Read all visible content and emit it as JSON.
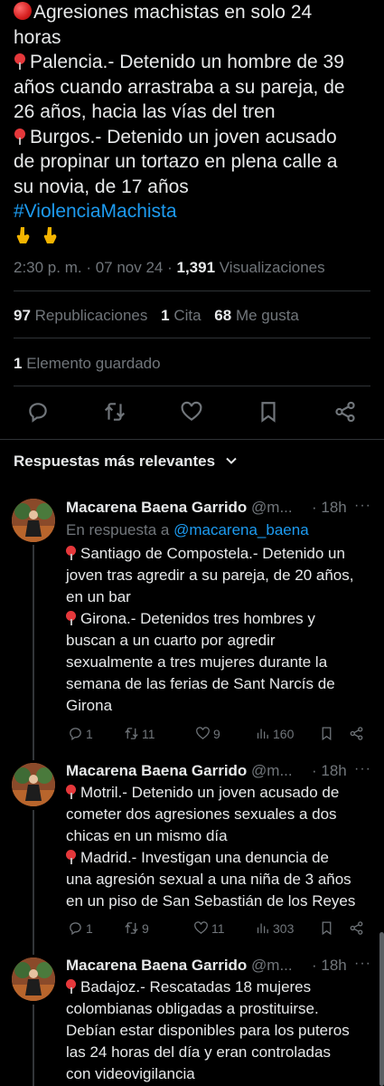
{
  "tweet": {
    "lines": [
      "Agresiones machistas en solo 24",
      "horas",
      "Palencia.- Detenido un hombre de 39",
      "años cuando arrastraba a su pareja, de",
      "26 años, hacia las vías del tren",
      "Burgos.- Detenido un joven acusado",
      "de propinar un tortazo en plena calle a",
      "su novia, de 17 años"
    ],
    "hashtag": "#ViolenciaMachista",
    "time": "2:30 p. m. · 07 nov 24 · ",
    "views_count": "1,391",
    "views_label": " Visualizaciones"
  },
  "stats": {
    "reposts_count": "97",
    "reposts_label": " Republicaciones",
    "quotes_count": "1",
    "quotes_label": " Cita",
    "likes_count": "68",
    "likes_label": " Me gusta",
    "saved_count": "1",
    "saved_label": " Elemento guardado"
  },
  "actions": [
    "reply-icon",
    "repost-icon",
    "like-icon",
    "bookmark-icon",
    "share-icon"
  ],
  "replies_header": "Respuestas más relevantes",
  "replies": [
    {
      "name": "Macarena Baena Garrido",
      "handle": " @m...",
      "time": "· 18h",
      "in_reply_prefix": "En respuesta a ",
      "in_reply_link": "@macarena_baena",
      "lines": [
        "Santiago de Compostela.- Detenido un",
        "joven tras agredir a su pareja, de 20 años,",
        "en un bar",
        "Girona.- Detenidos tres hombres y",
        "buscan a un cuarto por agredir",
        "sexualmente a tres mujeres durante la",
        "semana de las ferias de Sant Narcís de",
        "Girona"
      ],
      "replies_count": "1",
      "reposts_count": "11",
      "likes_count": "9",
      "views_count": "160"
    },
    {
      "name": "Macarena Baena Garrido",
      "handle": " @m...",
      "time": "· 18h",
      "lines": [
        "Motril.- Detenido un joven acusado de",
        "cometer dos agresiones sexuales a dos",
        "chicas en un mismo día",
        "Madrid.- Investigan una denuncia de",
        "una agresión sexual a una niña de 3 años",
        "en un piso de San Sebastián de los Reyes"
      ],
      "replies_count": "1",
      "reposts_count": "9",
      "likes_count": "11",
      "views_count": "303"
    },
    {
      "name": "Macarena Baena Garrido",
      "handle": " @m...",
      "time": "· 18h",
      "lines": [
        "Badajoz.- Rescatadas 18 mujeres",
        "colombianas obligadas a prostituirse.",
        "Debían estar disponibles para los puteros",
        "las 24 horas del día y eran controladas",
        "con videovigilancia"
      ]
    }
  ],
  "colors": {
    "background": "#000000",
    "text": "#e7e9ea",
    "secondary": "#71767b",
    "link": "#1d9bf0",
    "divider": "#2f3336"
  }
}
